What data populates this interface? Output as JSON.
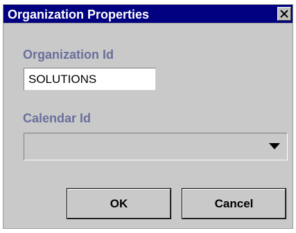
{
  "window": {
    "title": "Organization Properties",
    "close_icon": "close-icon"
  },
  "form": {
    "organization_id_label": "Organization Id",
    "organization_id_value": "SOLUTIONS",
    "calendar_id_label": "Calendar Id",
    "calendar_id_value": "",
    "dropdown_icon": "chevron-down-icon"
  },
  "buttons": {
    "ok_label": "OK",
    "cancel_label": "Cancel"
  },
  "colors": {
    "title_bar": "#000080",
    "title_text": "#ffffff",
    "panel_background": "#c9c9c9",
    "label_text": "#6a6f9c"
  }
}
